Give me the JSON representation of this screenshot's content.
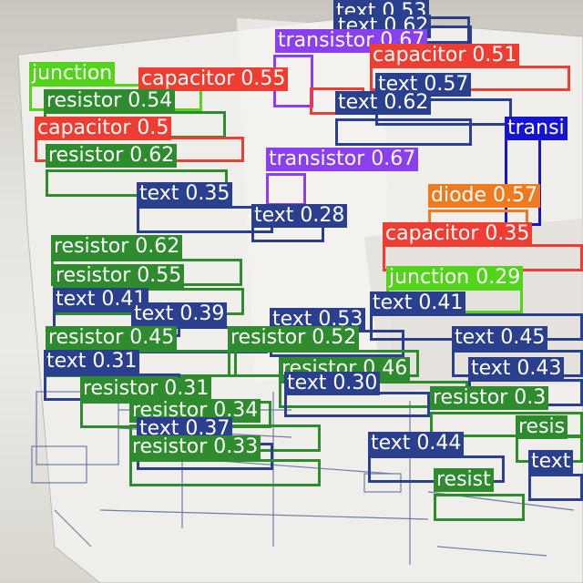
{
  "colors": {
    "text": "#2b3f8f",
    "resistor": "#2e8b2e",
    "capacitor": "#ef3d32",
    "transistor": "#8a3ff0",
    "junction": "#52d41a",
    "diode": "#f07a1e",
    "transistor_alt": "#1414d2"
  },
  "detections": [
    {
      "cls": "text",
      "label": "text 0.53"
    },
    {
      "cls": "text",
      "label": "text 0.62"
    },
    {
      "cls": "transistor",
      "label": "transistor 0.67"
    },
    {
      "cls": "capacitor",
      "label": "capacitor 0.51"
    },
    {
      "cls": "junction",
      "label": "junction"
    },
    {
      "cls": "capacitor",
      "label": "capacitor 0.55"
    },
    {
      "cls": "text",
      "label": "text 0.57"
    },
    {
      "cls": "resistor",
      "label": "resistor 0.54"
    },
    {
      "cls": "text",
      "label": "text 0.62"
    },
    {
      "cls": "capacitor",
      "label": "capacitor 0.5"
    },
    {
      "cls": "resistor",
      "label": "resistor 0.62"
    },
    {
      "cls": "transistor",
      "label": "transistor 0.67"
    },
    {
      "cls": "transistor_alt",
      "label": "transi"
    },
    {
      "cls": "text",
      "label": "text 0.35"
    },
    {
      "cls": "text",
      "label": "text 0.28"
    },
    {
      "cls": "diode",
      "label": "diode 0.57"
    },
    {
      "cls": "capacitor",
      "label": "capacitor 0.35"
    },
    {
      "cls": "resistor",
      "label": "resistor 0.62"
    },
    {
      "cls": "resistor",
      "label": "resistor 0.55"
    },
    {
      "cls": "junction",
      "label": "junction 0.29"
    },
    {
      "cls": "text",
      "label": "text 0.41"
    },
    {
      "cls": "text",
      "label": "text 0.41"
    },
    {
      "cls": "text",
      "label": "text 0.39"
    },
    {
      "cls": "text",
      "label": "text 0.53"
    },
    {
      "cls": "resistor",
      "label": "resistor 0.45"
    },
    {
      "cls": "resistor",
      "label": "resistor 0.52"
    },
    {
      "cls": "text",
      "label": "text 0.45"
    },
    {
      "cls": "text",
      "label": "text 0.31"
    },
    {
      "cls": "resistor",
      "label": "resistor 0.46"
    },
    {
      "cls": "text",
      "label": "text 0.43"
    },
    {
      "cls": "resistor",
      "label": "resistor 0.31"
    },
    {
      "cls": "text",
      "label": "text 0.30"
    },
    {
      "cls": "resistor",
      "label": "resistor 0.3"
    },
    {
      "cls": "resistor",
      "label": "resistor 0.34"
    },
    {
      "cls": "text",
      "label": "text 0.37"
    },
    {
      "cls": "resistor",
      "label": "resistor 0.33"
    },
    {
      "cls": "text",
      "label": "text 0.44"
    },
    {
      "cls": "resistor",
      "label": "resist"
    },
    {
      "cls": "resistor",
      "label": "resis"
    },
    {
      "cls": "text",
      "label": "text"
    }
  ]
}
